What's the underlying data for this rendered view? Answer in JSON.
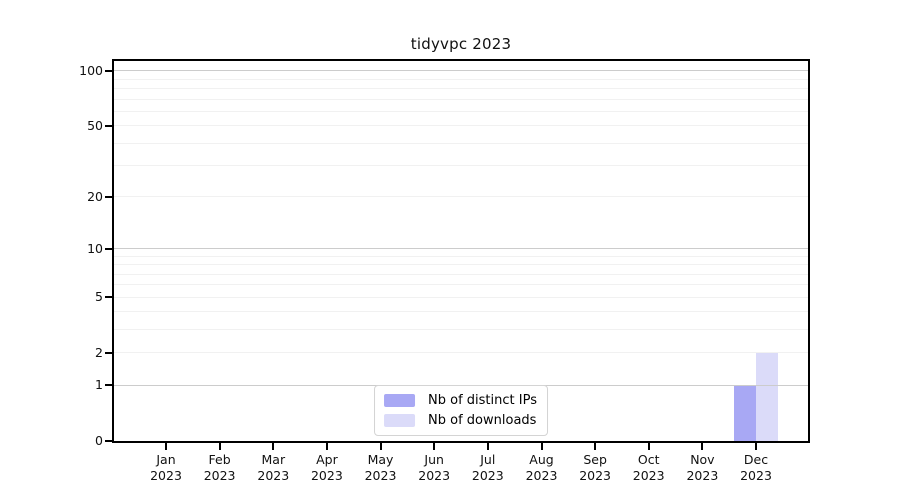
{
  "chart_data": {
    "type": "bar",
    "title": "tidyvpc 2023",
    "scale": "log1p",
    "categories": [
      "Jan",
      "Feb",
      "Mar",
      "Apr",
      "May",
      "Jun",
      "Jul",
      "Aug",
      "Sep",
      "Oct",
      "Nov",
      "Dec"
    ],
    "category_year": "2023",
    "series": [
      {
        "name": "Nb of distinct IPs",
        "color": "#a8a8f4",
        "values": [
          0,
          0,
          0,
          0,
          0,
          0,
          0,
          0,
          0,
          0,
          0,
          1
        ]
      },
      {
        "name": "Nb of downloads",
        "color": "#dbdbf9",
        "values": [
          0,
          0,
          0,
          0,
          0,
          0,
          0,
          0,
          0,
          0,
          0,
          2
        ]
      }
    ],
    "yticks": [
      0,
      1,
      2,
      5,
      10,
      20,
      50,
      100
    ],
    "grid_minor_values": [
      2,
      3,
      4,
      5,
      6,
      7,
      8,
      9,
      20,
      30,
      40,
      50,
      60,
      70,
      80,
      90
    ],
    "grid_major_values": [
      1,
      10,
      100
    ],
    "ylim": [
      0,
      113
    ],
    "xlabel": "",
    "ylabel": "",
    "grid": true,
    "legend_position": "lower center",
    "colors": {
      "axis": "#000000",
      "grid_minor": "#f1f1f1",
      "grid_major": "#cccccc",
      "background": "#ffffff",
      "text": "#111111"
    }
  }
}
